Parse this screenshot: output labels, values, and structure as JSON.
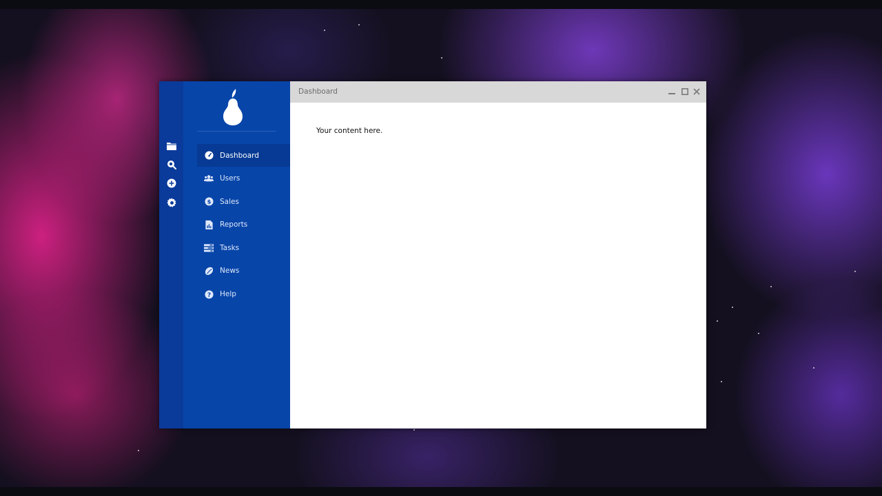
{
  "window": {
    "title": "Dashboard"
  },
  "iconbar": {
    "items": [
      {
        "icon": "folder-icon"
      },
      {
        "icon": "zoom-icon"
      },
      {
        "icon": "add-circle-icon"
      },
      {
        "icon": "gear-icon"
      }
    ]
  },
  "sidebar": {
    "logo": "pear-logo-icon",
    "items": [
      {
        "label": "Dashboard",
        "icon": "gauge-icon",
        "active": true
      },
      {
        "label": "Users",
        "icon": "users-icon"
      },
      {
        "label": "Sales",
        "icon": "dollar-icon"
      },
      {
        "label": "Reports",
        "icon": "report-icon"
      },
      {
        "label": "Tasks",
        "icon": "tasks-icon"
      },
      {
        "label": "News",
        "icon": "news-icon"
      },
      {
        "label": "Help",
        "icon": "help-icon"
      }
    ]
  },
  "content": {
    "text": "Your content here."
  },
  "colors": {
    "iconbar": "#0a3a9a",
    "sidebar": "#0745a9",
    "active_item": "#063a94",
    "titlebar": "#d8d8d8"
  }
}
